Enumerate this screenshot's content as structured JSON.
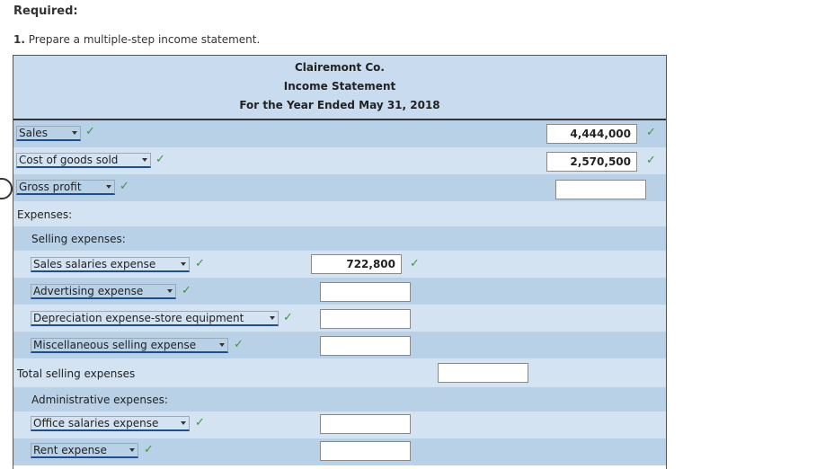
{
  "heading": "Required:",
  "instruction": {
    "number": "1.",
    "text": "Prepare a multiple-step income statement."
  },
  "statement": {
    "company": "Clairemont Co.",
    "title": "Income Statement",
    "period": "For the Year Ended May 31, 2018"
  },
  "rows": {
    "sales": {
      "label": "Sales",
      "value": "4,444,000"
    },
    "cogs": {
      "label": "Cost of goods sold",
      "value": "2,570,500"
    },
    "gross_profit": {
      "label": "Gross profit",
      "value": ""
    },
    "expenses": {
      "label": "Expenses:"
    },
    "selling": {
      "label": "Selling expenses:"
    },
    "sales_salaries": {
      "label": "Sales salaries expense",
      "value": "722,800"
    },
    "advertising": {
      "label": "Advertising expense",
      "value": ""
    },
    "depreciation": {
      "label": "Depreciation expense-store equipment",
      "value": ""
    },
    "misc_selling": {
      "label": "Miscellaneous selling expense",
      "value": ""
    },
    "total_selling": {
      "label": "Total selling expenses",
      "value": ""
    },
    "admin": {
      "label": "Administrative expenses:"
    },
    "office_salaries": {
      "label": "Office salaries expense",
      "value": ""
    },
    "rent": {
      "label": "Rent expense",
      "value": ""
    }
  },
  "check_glyph": "✓",
  "colors": {
    "header_bg": "#c9dcef",
    "row_dark": "#b9d1e7",
    "row_light": "#d4e3f2",
    "check": "#3a9a3a",
    "dropdown_underline": "#1a4f91"
  }
}
